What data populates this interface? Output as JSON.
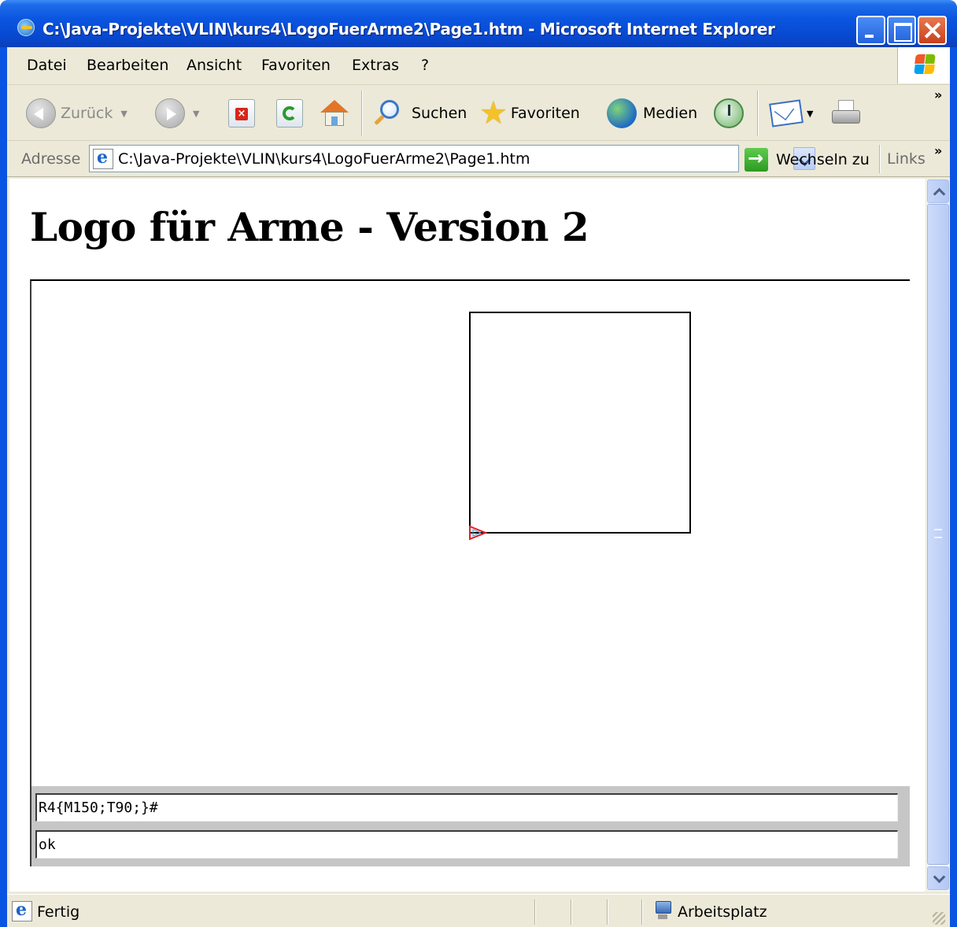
{
  "window": {
    "title": "C:\\Java-Projekte\\VLIN\\kurs4\\LogoFuerArme2\\Page1.htm - Microsoft Internet Explorer"
  },
  "menu": {
    "items": [
      "Datei",
      "Bearbeiten",
      "Ansicht",
      "Favoriten",
      "Extras",
      "?"
    ]
  },
  "toolbar": {
    "back_label": "Zurück",
    "search_label": "Suchen",
    "favorites_label": "Favoriten",
    "media_label": "Medien",
    "overflow": "»"
  },
  "address": {
    "label": "Adresse",
    "url": "C:\\Java-Projekte\\VLIN\\kurs4\\LogoFuerArme2\\Page1.htm",
    "go_label": "Wechseln zu",
    "links_label": "Links",
    "overflow": "»"
  },
  "page": {
    "heading": "Logo für Arme - Version 2",
    "command_value": "R4{M150;T90;}#",
    "output_value": "ok"
  },
  "status": {
    "text": "Fertig",
    "zone": "Arbeitsplatz"
  },
  "colors": {
    "titlebar": "#0a55e0",
    "chrome": "#ece9d8",
    "turtle": "#e02020"
  }
}
